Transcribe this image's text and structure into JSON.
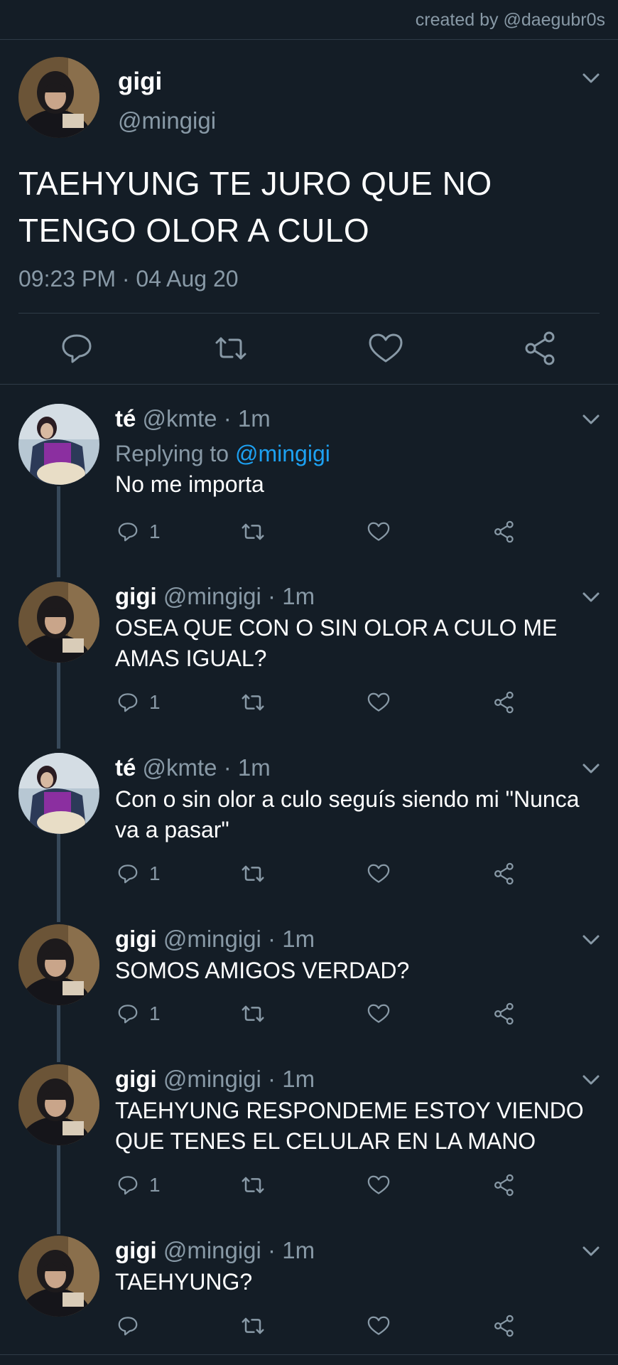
{
  "credit": "created by @daegubr0s",
  "main": {
    "name": "gigi",
    "handle": "@mingigi",
    "text": "TAEHYUNG TE JURO QUE NO TENGO OLOR A CULO",
    "timestamp": "09:23 PM · 04 Aug 20"
  },
  "replies": [
    {
      "name": "té",
      "handle": "@kmte",
      "time": "1m",
      "replying_label": "Replying to",
      "replying_to": "@mingigi",
      "text": "No me importa",
      "reply_count": "1"
    },
    {
      "name": "gigi",
      "handle": "@mingigi",
      "time": "1m",
      "text": "OSEA QUE CON O SIN OLOR A CULO ME AMAS IGUAL?",
      "reply_count": "1"
    },
    {
      "name": "té",
      "handle": "@kmte",
      "time": "1m",
      "text": "Con o sin olor a culo seguís siendo mi \"Nunca va a pasar\"",
      "reply_count": "1"
    },
    {
      "name": "gigi",
      "handle": "@mingigi",
      "time": "1m",
      "text": "SOMOS AMIGOS VERDAD?",
      "reply_count": "1"
    },
    {
      "name": "gigi",
      "handle": "@mingigi",
      "time": "1m",
      "text": "TAEHYUNG RESPONDEME ESTOY VIENDO QUE TENES EL CELULAR EN LA MANO",
      "reply_count": "1"
    },
    {
      "name": "gigi",
      "handle": "@mingigi",
      "time": "1m",
      "text": "TAEHYUNG?",
      "reply_count": ""
    }
  ],
  "separator": "·",
  "icons": {
    "reply": "reply-icon",
    "retweet": "retweet-icon",
    "like": "heart-icon",
    "share": "share-icon",
    "menu": "chevron-down-icon"
  },
  "colors": {
    "background": "#141d26",
    "secondary_text": "#8899a6",
    "link": "#1da1f2",
    "thread_line": "#37495a"
  }
}
